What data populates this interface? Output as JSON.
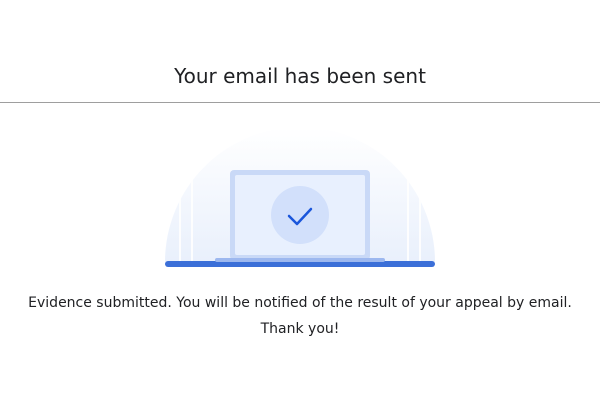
{
  "header": {
    "title": "Your email has been sent"
  },
  "illustration": {
    "icon": "laptop-checkmark-icon",
    "colors": {
      "arc_bg": "#eef3fc",
      "laptop_screen": "#e8f0fe",
      "laptop_frame": "#c6d7f7",
      "check_circle": "#d2e0fb",
      "check_mark": "#1a56db",
      "base_bar": "#3b6fd8"
    }
  },
  "message": {
    "text": "Evidence submitted. You will be notified of the result of your appeal by email. Thank you!"
  }
}
